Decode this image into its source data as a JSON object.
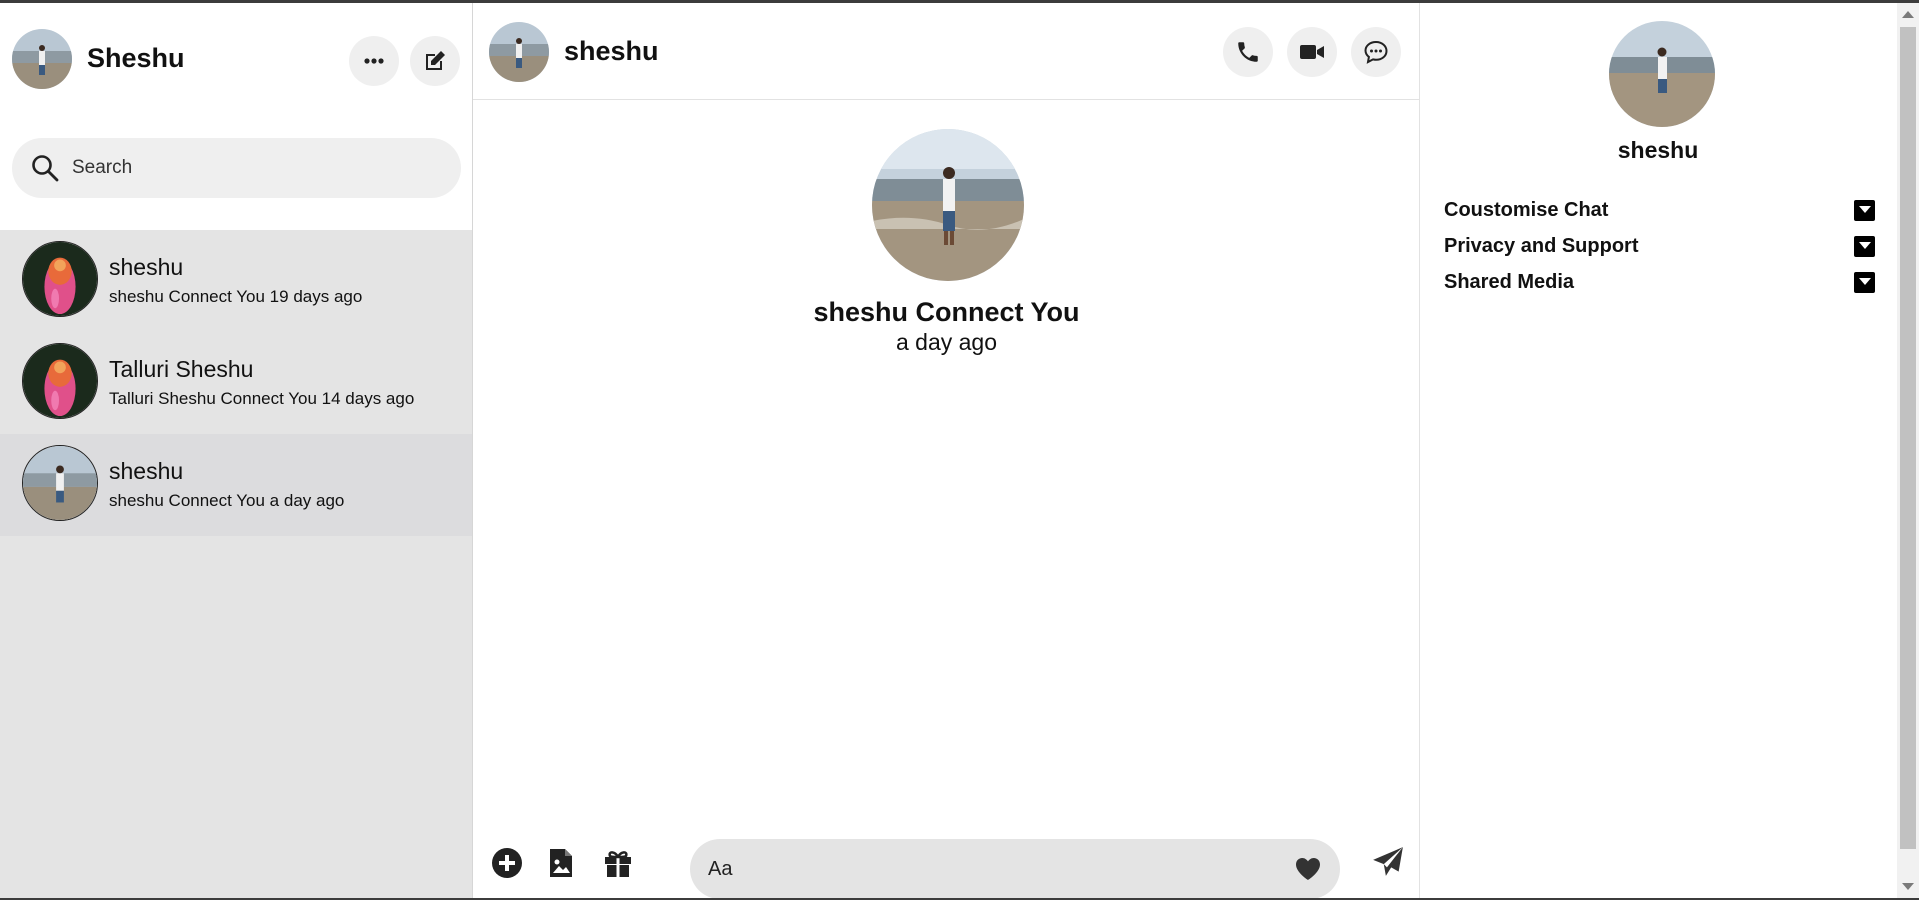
{
  "sidebar": {
    "title": "Sheshu",
    "more_icon": "more-horizontal-icon",
    "compose_icon": "compose-icon",
    "search": {
      "placeholder": "Search",
      "value": ""
    },
    "conversations": [
      {
        "name": "sheshu",
        "preview": "sheshu Connect You 19 days ago",
        "avatar": "flower-avatar",
        "active": false
      },
      {
        "name": "Talluri Sheshu",
        "preview": "Talluri Sheshu Connect You 14 days ago",
        "avatar": "flower-avatar",
        "active": false
      },
      {
        "name": "sheshu",
        "preview": "sheshu Connect You a day ago",
        "avatar": "beach-avatar",
        "active": true
      }
    ]
  },
  "chat": {
    "title": "sheshu",
    "intro_name": "sheshu Connect You",
    "intro_time": "a day ago",
    "composer": {
      "placeholder": "Aa",
      "value": ""
    },
    "icons": [
      "phone-icon",
      "video-icon",
      "chat-bubble-icon",
      "plus-circle-icon",
      "image-file-icon",
      "gift-icon",
      "heart-icon",
      "send-icon"
    ]
  },
  "info": {
    "name": "sheshu",
    "sections": [
      "Coustomise Chat",
      "Privacy and Support",
      "Shared Media"
    ]
  },
  "colors": {
    "sidebar_bg": "#e4e4e4",
    "active_row": "#dcdcde",
    "button_bg": "#efefef",
    "input_bg": "#e4e4e4"
  }
}
